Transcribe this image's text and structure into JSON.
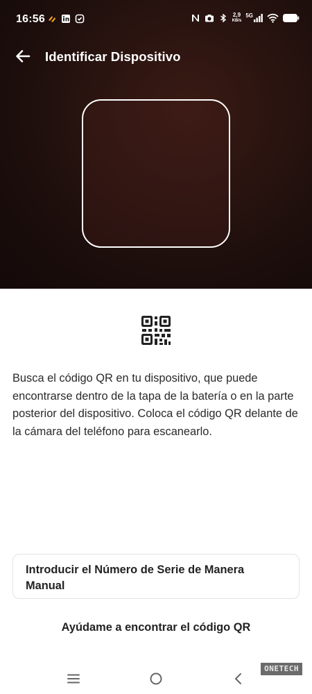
{
  "status_bar": {
    "time": "16:56",
    "left_icons": [
      "notification-icon",
      "linkedin-icon",
      "shield-icon"
    ],
    "right_icons": [
      "nfc-icon",
      "camera-icon",
      "bluetooth-icon"
    ],
    "speed_value": "2,9",
    "speed_unit": "KB/s",
    "network_type": "5G",
    "signal_icon": "signal-icon",
    "wifi_icon": "wifi-icon",
    "battery_icon": "battery-icon"
  },
  "header": {
    "title": "Identificar Dispositivo",
    "back_icon": "arrow-left-icon"
  },
  "main": {
    "qr_icon": "qr-code-icon",
    "instructions": "Busca el código QR en tu dispositivo, que puede encontrarse dentro de la tapa de la batería o en la parte posterior del dispositivo. Coloca el código QR delante de la cámara del teléfono para escanearlo.",
    "manual_entry_label": "Introducir el Número de Serie de Manera Manual",
    "help_link_label": "Ayúdame a encontrar el código QR"
  },
  "navigation_bar": {
    "menu_icon": "menu-icon",
    "home_icon": "home-icon",
    "back_icon": "chevron-left-icon"
  },
  "watermark": "ONETECH"
}
